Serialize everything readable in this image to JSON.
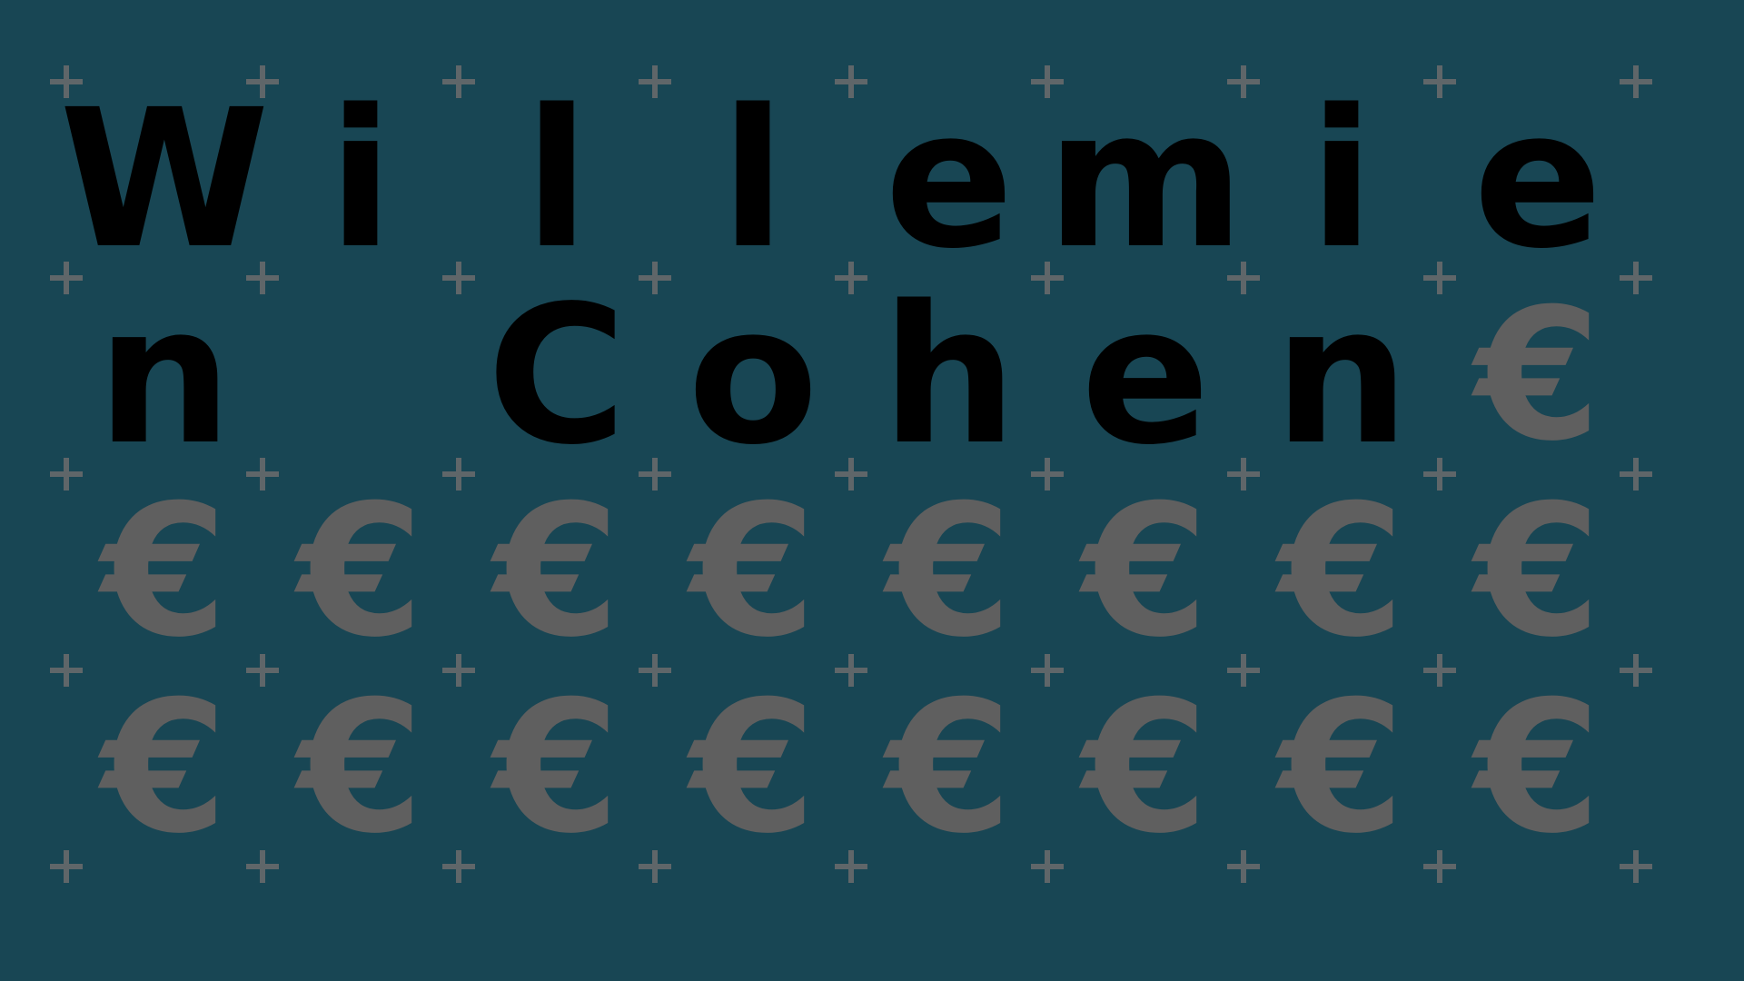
{
  "name": {
    "line1": "Willemie",
    "line2": "n Cohen"
  },
  "filler_symbol": "€",
  "colors": {
    "background": "#184654",
    "text": "#000000",
    "symbol": "#5f5f5f",
    "plus": "#5f6669"
  }
}
